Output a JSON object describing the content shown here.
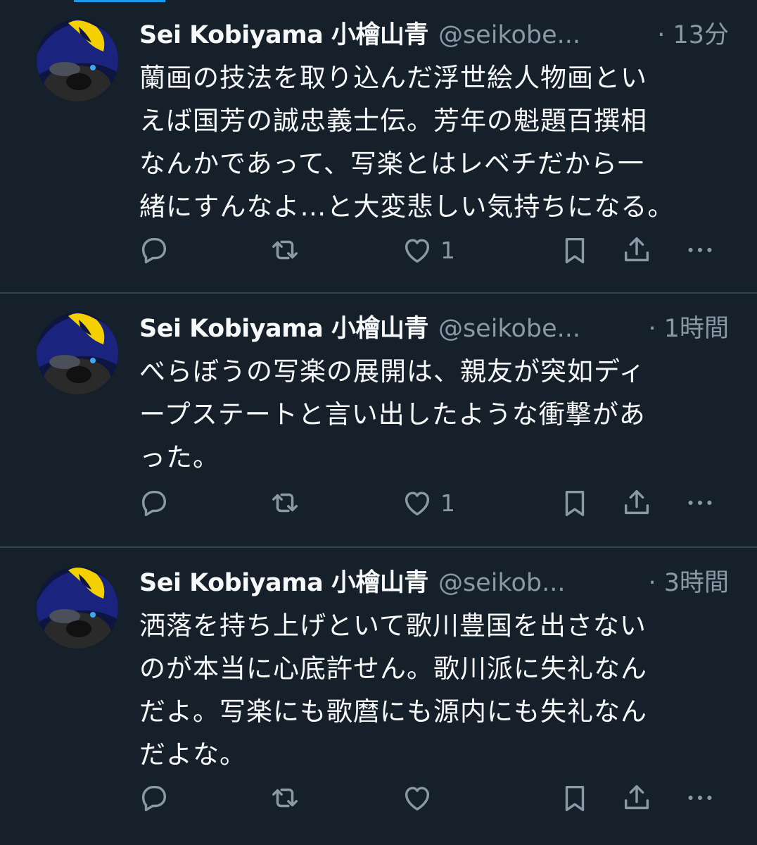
{
  "tweets": [
    {
      "author_name": "Sei Kobiyama 小檜山青",
      "handle": "@seikobe...",
      "time": "· 13分",
      "text": "蘭画の技法を取り込んだ浮世絵人物画とい\nえば国芳の誠忠義士伝。芳年の魁題百撰相\nなんかであって、写楽とはレベチだから一\n緒にすんなよ…と大変悲しい気持ちになる。",
      "like_count": "1"
    },
    {
      "author_name": "Sei Kobiyama 小檜山青",
      "handle": "@seikobe...",
      "time": "· 1時間",
      "text": "べらぼうの写楽の展開は、親友が突如ディ\nープステートと言い出したような衝撃があ\nった。",
      "like_count": "1"
    },
    {
      "author_name": "Sei Kobiyama 小檜山青",
      "handle": "@seikob...",
      "time": "· 3時間",
      "text": "洒落を持ち上げといて歌川豊国を出さない\nのが本当に心底許せん。歌川派に失礼なん\nだよ。写楽にも歌麿にも源内にも失礼なん\nだよな。",
      "like_count": ""
    }
  ],
  "icons": {
    "reply": "reply-icon",
    "retweet": "retweet-icon",
    "like": "heart-icon",
    "bookmark": "bookmark-icon",
    "share": "share-icon",
    "more": "more-icon"
  },
  "colors": {
    "background": "#15202b",
    "text_primary": "#f7f9f9",
    "text_secondary": "#8b98a5",
    "divider": "#38444d",
    "accent": "#1d9bf0"
  }
}
